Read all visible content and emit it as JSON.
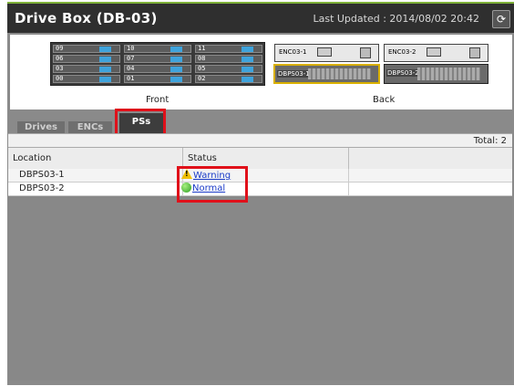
{
  "window": {
    "title": "Drive Box (DB-03)",
    "last_updated": "Last Updated : 2014/08/02 20:42",
    "refresh_glyph": "⟳"
  },
  "diagram": {
    "front_slots": [
      "09",
      "10",
      "11",
      "06",
      "07",
      "08",
      "03",
      "04",
      "05",
      "00",
      "01",
      "02"
    ],
    "front_label": "Front",
    "back_label": "Back",
    "encs": [
      "ENC03-1",
      "ENC03-2"
    ],
    "pss": [
      "DBPS03-1",
      "DBPS03-2"
    ]
  },
  "tabs": [
    {
      "label": "Drives"
    },
    {
      "label": "ENCs"
    },
    {
      "label": "PSs"
    }
  ],
  "total_text": "Total: 2",
  "table": {
    "columns": [
      "Location",
      "Status",
      ""
    ],
    "rows": [
      {
        "location": "DBPS03-1",
        "status": "Warning",
        "icon": "warning-icon"
      },
      {
        "location": "DBPS03-2",
        "status": "Normal",
        "icon": "normal-status-icon"
      }
    ]
  },
  "colors": {
    "accent": "#7fb13a",
    "highlight": "#e0101a",
    "link": "#1a3ac8"
  }
}
